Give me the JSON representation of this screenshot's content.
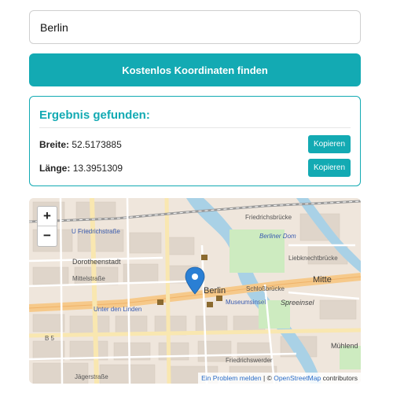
{
  "search": {
    "value": "Berlin"
  },
  "find_button": {
    "label": "Kostenlos Koordinaten finden"
  },
  "result": {
    "title": "Ergebnis gefunden:",
    "latitude": {
      "label": "Breite:",
      "value": "52.5173885",
      "copy_label": "Kopieren"
    },
    "longitude": {
      "label": "Länge:",
      "value": "13.3951309",
      "copy_label": "Kopieren"
    }
  },
  "map": {
    "zoom_in": "+",
    "zoom_out": "−",
    "labels": {
      "friedrichstrasse": "U Friedrichstraße",
      "friedrichsbruecke": "Friedrichsbrücke",
      "dorotheenstadt": "Dorotheenstadt",
      "berliner_dom": "Berliner Dom",
      "liebknechtbruecke": "Liebknechtbrücke",
      "mittelstrasse": "Mittelstraße",
      "berlin": "Berlin",
      "schlossbruecke": "Schloßbrücke",
      "mitte": "Mitte",
      "museumsinsel": "Museumsinsel",
      "spreeinsel": "Spreeinsel",
      "unter_den_linden": "Unter den Linden",
      "b5": "B 5",
      "muehlend": "Mühlend",
      "friedrichswerder": "Friedrichswerder",
      "jaegerstrasse": "Jägerstraße"
    },
    "attribution": {
      "report": "Ein Problem melden",
      "separator": " | © ",
      "osm": "OpenStreetMap",
      "contributors": " contributors"
    }
  },
  "colors": {
    "accent": "#13aab3",
    "marker": "#2a7fd4"
  },
  "icons": {
    "marker": "map-marker-icon"
  }
}
